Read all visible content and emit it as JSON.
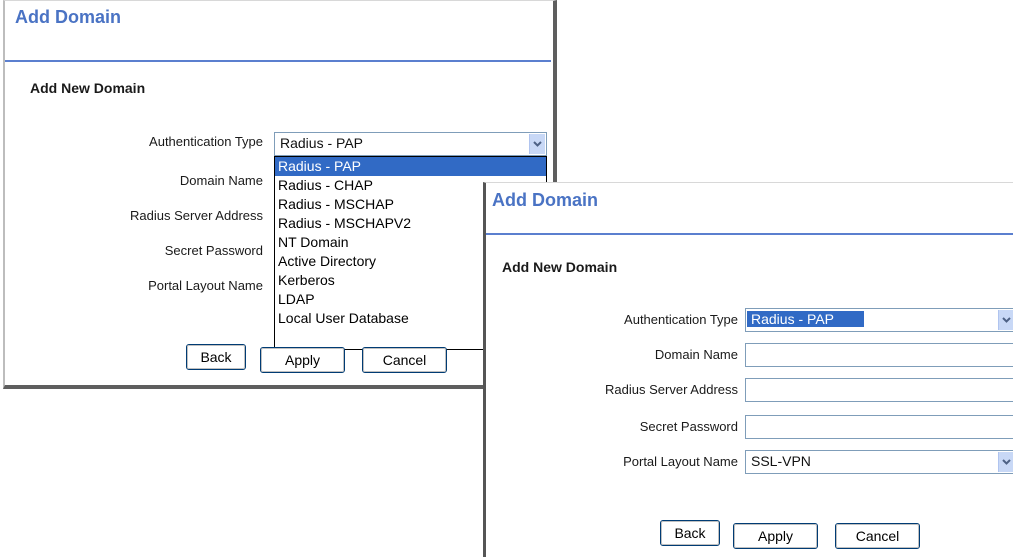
{
  "window1": {
    "title": "Add Domain",
    "subtitle": "Add New Domain",
    "labels": {
      "auth_type": "Authentication Type",
      "domain_name": "Domain Name",
      "radius_server": "Radius Server Address",
      "secret_password": "Secret Password",
      "portal_layout": "Portal Layout Name"
    },
    "auth_type_value": "Radius - PAP",
    "dropdown_options": [
      "Radius - PAP",
      "Radius - CHAP",
      "Radius - MSCHAP",
      "Radius - MSCHAPV2",
      "NT Domain",
      "Active Directory",
      "Kerberos",
      "LDAP",
      "Local User Database"
    ],
    "dropdown_selected": "Radius - PAP",
    "buttons": {
      "back": "Back",
      "apply": "Apply",
      "cancel": "Cancel"
    }
  },
  "window2": {
    "title": "Add Domain",
    "subtitle": "Add New Domain",
    "labels": {
      "auth_type": "Authentication Type",
      "domain_name": "Domain Name",
      "radius_server": "Radius Server Address",
      "secret_password": "Secret Password",
      "portal_layout": "Portal Layout Name"
    },
    "auth_type_value": "Radius - PAP",
    "domain_name_value": "",
    "radius_server_value": "",
    "secret_password_value": "",
    "portal_layout_value": "SSL-VPN",
    "buttons": {
      "back": "Back",
      "apply": "Apply",
      "cancel": "Cancel"
    }
  },
  "colors": {
    "title": "#4a73c4",
    "rule": "#5b7fcf",
    "selection": "#316ac5"
  },
  "icons": {
    "select_arrow": "chevron-down-icon"
  }
}
